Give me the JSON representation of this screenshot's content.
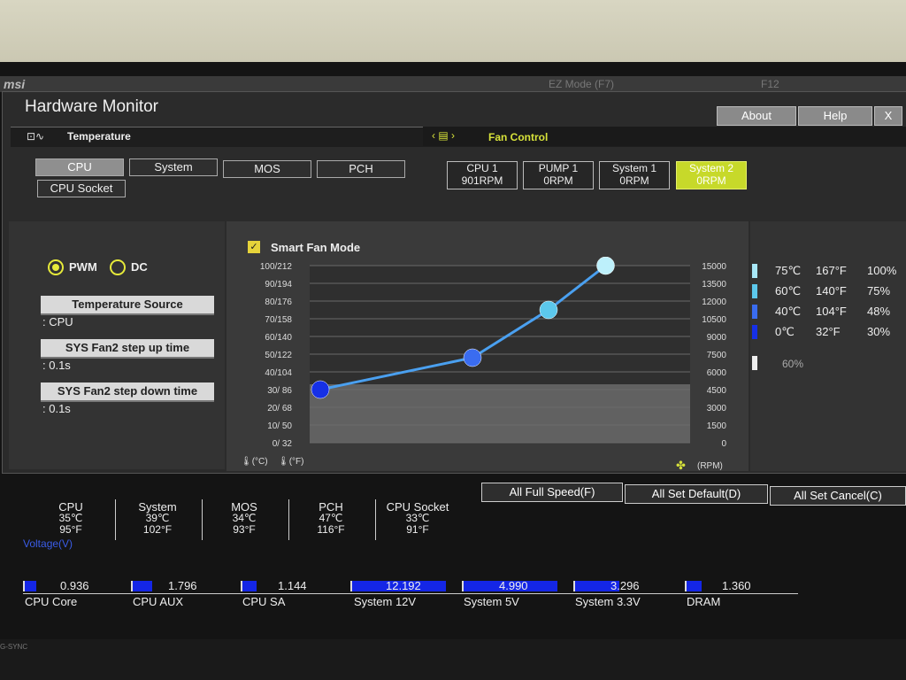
{
  "window": {
    "title": "Hardware Monitor",
    "about": "About",
    "help": "Help",
    "close": "X"
  },
  "topbar": {
    "logo": "msi",
    "ez_mode": "EZ Mode (F7)",
    "f12": "F12"
  },
  "temperature": {
    "header": "Temperature",
    "sources": [
      "CPU",
      "System",
      "MOS",
      "PCH",
      "CPU Socket"
    ],
    "active": "CPU"
  },
  "fan_control": {
    "header": "Fan Control",
    "fans": [
      {
        "name": "CPU 1",
        "rpm": "901RPM"
      },
      {
        "name": "PUMP 1",
        "rpm": "0RPM"
      },
      {
        "name": "System 1",
        "rpm": "0RPM"
      },
      {
        "name": "System 2",
        "rpm": "0RPM"
      }
    ],
    "active": "System 2"
  },
  "settings": {
    "pwm": "PWM",
    "dc": "DC",
    "temp_source_label": "Temperature Source",
    "temp_source_value": ": CPU",
    "step_up_label": "SYS Fan2 step up time",
    "step_up_value": ": 0.1s",
    "step_down_label": "SYS Fan2 step down time",
    "step_down_value": ": 0.1s"
  },
  "chart_data": {
    "type": "line",
    "title": "Smart Fan Mode",
    "y_left_ticks": [
      "100/212",
      "90/194",
      "80/176",
      "70/158",
      "60/140",
      "50/122",
      "40/104",
      "30/ 86",
      "20/ 68",
      "10/ 50",
      "0/ 32"
    ],
    "y_right_ticks": [
      "15000",
      "13500",
      "12000",
      "10500",
      "9000",
      "7500",
      "6000",
      "4500",
      "3000",
      "1500",
      "0"
    ],
    "x_units": "(°C)",
    "x_units_f": "(°F)",
    "rpm_units": "(RPM)",
    "grid": true,
    "series": [
      {
        "points": [
          {
            "temp_c": 0,
            "percent": 30
          },
          {
            "temp_c": 40,
            "percent": 48
          },
          {
            "temp_c": 60,
            "percent": 75
          },
          {
            "temp_c": 75,
            "percent": 100
          }
        ]
      }
    ],
    "ylim": [
      0,
      100
    ]
  },
  "curve_table": [
    {
      "c": "75℃",
      "f": "167°F",
      "pct": "100%",
      "color": "#a8e8f8"
    },
    {
      "c": "60℃",
      "f": "140°F",
      "pct": "75%",
      "color": "#5cc8ec"
    },
    {
      "c": "40℃",
      "f": "104°F",
      "pct": "48%",
      "color": "#3a6cf0"
    },
    {
      "c": "0℃",
      "f": "32°F",
      "pct": "30%",
      "color": "#1630e6"
    }
  ],
  "curve_extra": "60%",
  "actions": {
    "full_speed": "All Full Speed(F)",
    "set_default": "All Set Default(D)",
    "set_cancel": "All Set Cancel(C)"
  },
  "temps": [
    {
      "name": "CPU",
      "c": "35℃",
      "f": "95°F"
    },
    {
      "name": "System",
      "c": "39℃",
      "f": "102°F"
    },
    {
      "name": "MOS",
      "c": "34℃",
      "f": "93°F"
    },
    {
      "name": "PCH",
      "c": "47℃",
      "f": "116°F"
    },
    {
      "name": "CPU Socket",
      "c": "33℃",
      "f": "91°F"
    }
  ],
  "voltage": {
    "label": "Voltage(V)",
    "items": [
      {
        "name": "CPU Core",
        "value": "0.936",
        "fill": 0.12
      },
      {
        "name": "CPU AUX",
        "value": "1.796",
        "fill": 0.2
      },
      {
        "name": "CPU SA",
        "value": "1.144",
        "fill": 0.14
      },
      {
        "name": "System 12V",
        "value": "12.192",
        "fill": 0.95
      },
      {
        "name": "System 5V",
        "value": "4.990",
        "fill": 0.95
      },
      {
        "name": "System 3.3V",
        "value": "3.296",
        "fill": 0.45
      },
      {
        "name": "DRAM",
        "value": "1.360",
        "fill": 0.15
      }
    ]
  },
  "monitor": {
    "brand": "G-SYNC"
  }
}
